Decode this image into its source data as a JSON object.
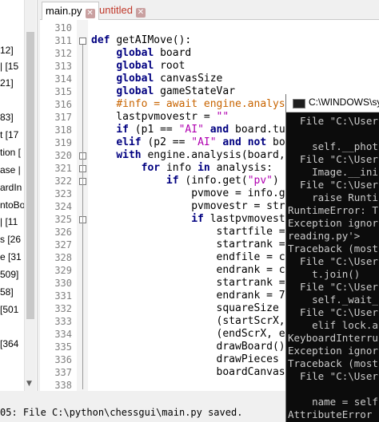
{
  "sidebar": {
    "items": [
      "12]",
      "| [15",
      "21]",
      "83]",
      "t [17",
      "tion [",
      "ase |",
      "ardIn",
      "ntoBo",
      "| [11",
      "s [26",
      "e [31",
      "509]",
      "58]",
      "[501",
      "[364"
    ]
  },
  "tabs": [
    {
      "label": "main.py",
      "active": true
    },
    {
      "label": "untitled",
      "active": false
    }
  ],
  "editor": {
    "line_numbers": [
      "310",
      "311",
      "312",
      "313",
      "314",
      "315",
      "316",
      "317",
      "318",
      "319",
      "320",
      "321",
      "322",
      "323",
      "324",
      "325",
      "326",
      "327",
      "328",
      "329",
      "330",
      "331",
      "332",
      "333",
      "334",
      "335",
      "336",
      "337",
      "338"
    ],
    "lines": [
      [],
      [
        {
          "t": "def ",
          "c": "kw"
        },
        {
          "t": "getAIMove():",
          "c": ""
        }
      ],
      [
        {
          "t": "    ",
          "c": ""
        },
        {
          "t": "global ",
          "c": "kw"
        },
        {
          "t": "board",
          "c": ""
        }
      ],
      [
        {
          "t": "    ",
          "c": ""
        },
        {
          "t": "global ",
          "c": "kw"
        },
        {
          "t": "root",
          "c": ""
        }
      ],
      [
        {
          "t": "    ",
          "c": ""
        },
        {
          "t": "global ",
          "c": "kw"
        },
        {
          "t": "canvasSize",
          "c": ""
        }
      ],
      [
        {
          "t": "    ",
          "c": ""
        },
        {
          "t": "global ",
          "c": "kw"
        },
        {
          "t": "gameStateVar",
          "c": ""
        }
      ],
      [
        {
          "t": "    ",
          "c": ""
        },
        {
          "t": "#info = await engine.analysis",
          "c": "cm"
        }
      ],
      [
        {
          "t": "    lastpvmovestr = ",
          "c": ""
        },
        {
          "t": "\"\"",
          "c": "str"
        }
      ],
      [
        {
          "t": "    ",
          "c": ""
        },
        {
          "t": "if ",
          "c": "kw"
        },
        {
          "t": "(p1 == ",
          "c": ""
        },
        {
          "t": "\"AI\"",
          "c": "str"
        },
        {
          "t": " ",
          "c": ""
        },
        {
          "t": "and ",
          "c": "kw"
        },
        {
          "t": "board.tu",
          "c": ""
        }
      ],
      [
        {
          "t": "    ",
          "c": ""
        },
        {
          "t": "elif ",
          "c": "kw"
        },
        {
          "t": "(p2 == ",
          "c": ""
        },
        {
          "t": "\"AI\"",
          "c": "str"
        },
        {
          "t": " ",
          "c": ""
        },
        {
          "t": "and not ",
          "c": "kw"
        },
        {
          "t": "bo",
          "c": ""
        }
      ],
      [
        {
          "t": "    ",
          "c": ""
        },
        {
          "t": "with ",
          "c": "kw"
        },
        {
          "t": "engine.analysis(board,",
          "c": ""
        }
      ],
      [
        {
          "t": "        ",
          "c": ""
        },
        {
          "t": "for ",
          "c": "kw"
        },
        {
          "t": "info ",
          "c": ""
        },
        {
          "t": "in ",
          "c": "kw"
        },
        {
          "t": "analysis:",
          "c": ""
        }
      ],
      [
        {
          "t": "            ",
          "c": ""
        },
        {
          "t": "if ",
          "c": "kw"
        },
        {
          "t": "(info.get(",
          "c": ""
        },
        {
          "t": "\"pv\"",
          "c": "str"
        },
        {
          "t": ")",
          "c": ""
        }
      ],
      [
        {
          "t": "                pvmove = info.g",
          "c": ""
        }
      ],
      [
        {
          "t": "                pvmovestr = str",
          "c": ""
        }
      ],
      [
        {
          "t": "                ",
          "c": ""
        },
        {
          "t": "if ",
          "c": "kw"
        },
        {
          "t": "lastpvmovest",
          "c": ""
        }
      ],
      [
        {
          "t": "                    startfile =",
          "c": ""
        }
      ],
      [
        {
          "t": "                    startrank =",
          "c": ""
        }
      ],
      [
        {
          "t": "                    endfile = c",
          "c": ""
        }
      ],
      [
        {
          "t": "                    endrank = c",
          "c": ""
        }
      ],
      [
        {
          "t": "                    startrank =",
          "c": ""
        }
      ],
      [
        {
          "t": "                    endrank = 7",
          "c": ""
        }
      ],
      [
        {
          "t": "                    squareSize",
          "c": ""
        }
      ],
      [
        {
          "t": "                    (startScrX,",
          "c": ""
        }
      ],
      [
        {
          "t": "                    (endScrX, e",
          "c": ""
        }
      ],
      [
        {
          "t": "                    drawBoard()",
          "c": ""
        }
      ],
      [
        {
          "t": "                    drawPieces",
          "c": ""
        }
      ],
      [
        {
          "t": "                    boardCanvas",
          "c": ""
        }
      ],
      []
    ]
  },
  "console": {
    "title": "C:\\WINDOWS\\sy",
    "lines": [
      "  File \"C:\\User",
      "",
      "    self.__phot",
      "  File \"C:\\User",
      "    Image.__ini",
      "  File \"C:\\User",
      "    raise Runti",
      "RuntimeError: T",
      "Exception ignor",
      "reading.py'>",
      "Traceback (most",
      "  File \"C:\\User",
      "    t.join()",
      "  File \"C:\\User",
      "    self._wait_",
      "  File \"C:\\User",
      "    elif lock.a",
      "KeyboardInterru",
      "Exception ignor",
      "Traceback (most",
      "  File \"C:\\User",
      "",
      "    name = self",
      "AttributeError"
    ]
  },
  "status": {
    "text": "05: File C:\\python\\chessgui\\main.py saved."
  },
  "colors": {
    "keyword": "#000080",
    "string": "#b000b0",
    "comment": "#c86400",
    "console_bg": "#0c0c0c",
    "console_text": "#cccccc"
  }
}
